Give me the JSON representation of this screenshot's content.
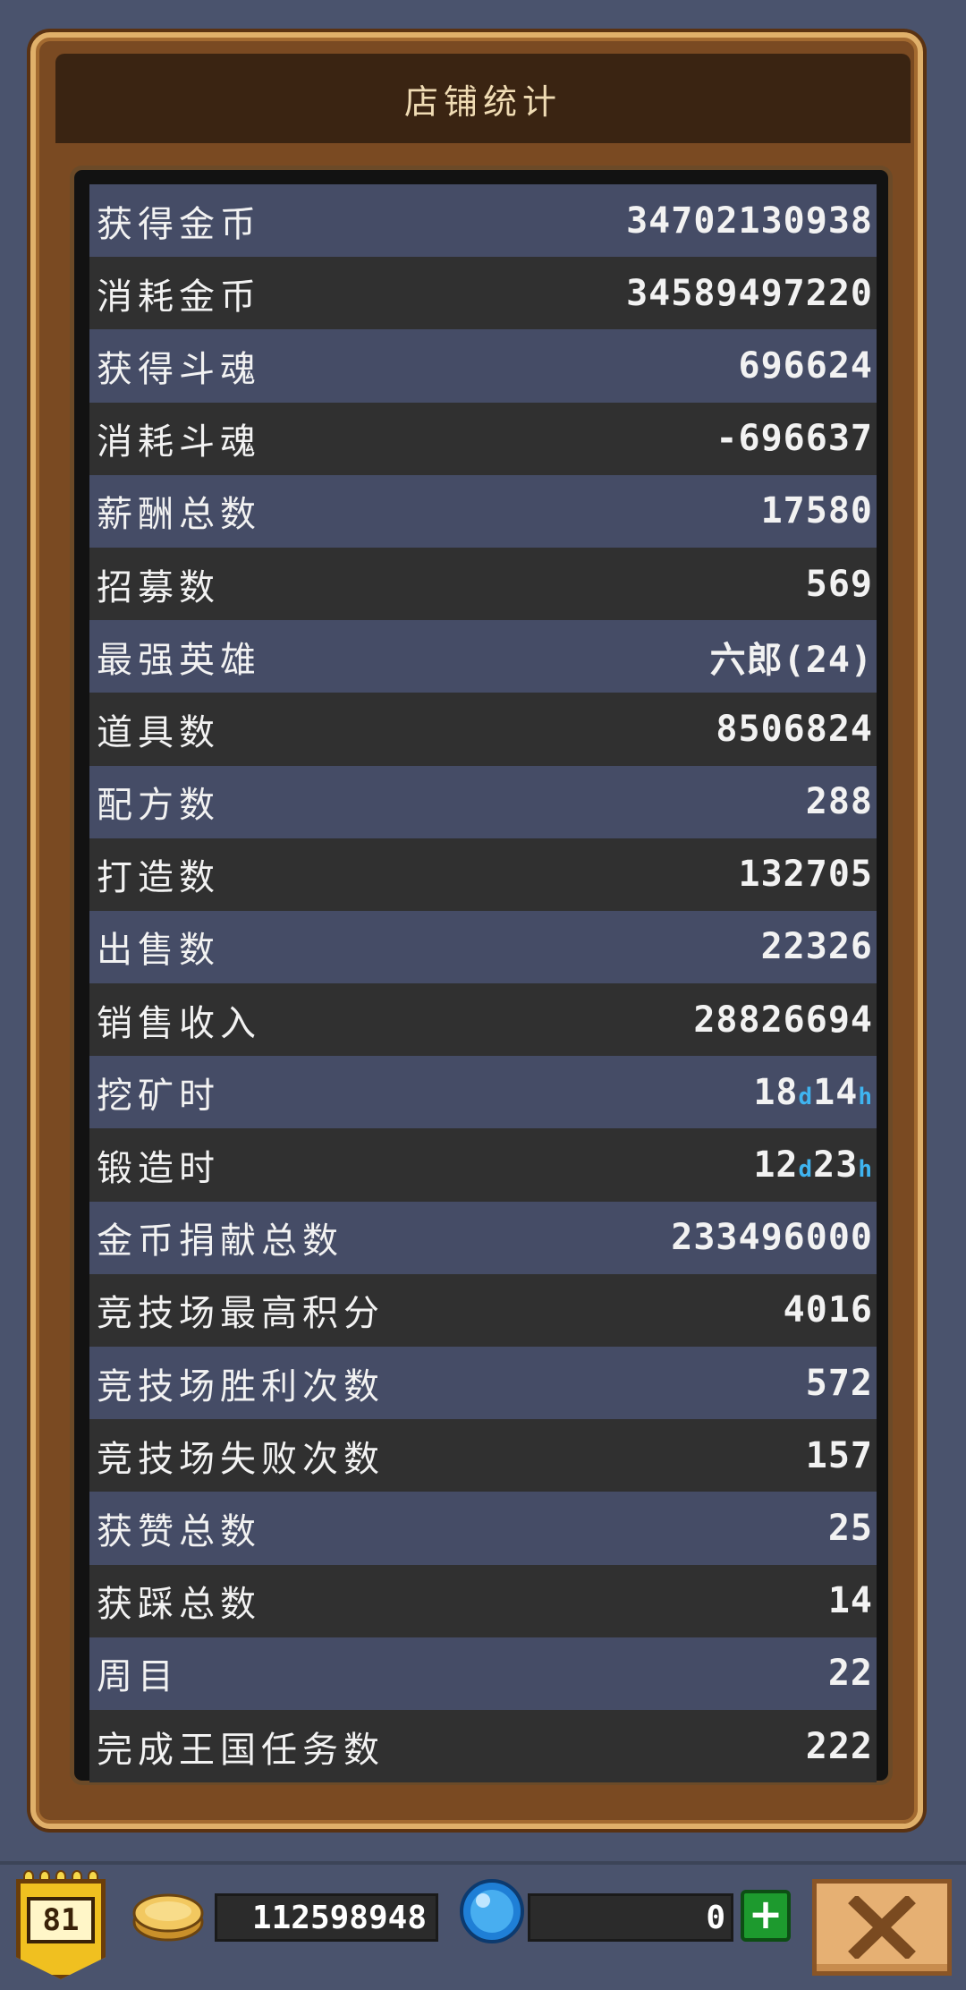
{
  "header": {
    "title": "店铺统计"
  },
  "stats": [
    {
      "label": "获得金币",
      "value": "34702130938"
    },
    {
      "label": "消耗金币",
      "value": "34589497220"
    },
    {
      "label": "获得斗魂",
      "value": "696624"
    },
    {
      "label": "消耗斗魂",
      "value": "-696637"
    },
    {
      "label": "薪酬总数",
      "value": "17580"
    },
    {
      "label": "招募数",
      "value": "569"
    },
    {
      "label": "最强英雄",
      "value": "六郎(24)"
    },
    {
      "label": "道具数",
      "value": "8506824"
    },
    {
      "label": "配方数",
      "value": "288"
    },
    {
      "label": "打造数",
      "value": "132705"
    },
    {
      "label": "出售数",
      "value": "22326"
    },
    {
      "label": "销售收入",
      "value": "28826694"
    },
    {
      "label": "挖矿时",
      "value_num1": "18",
      "unit1": "d",
      "value_num2": "14",
      "unit2": "h"
    },
    {
      "label": "锻造时",
      "value_num1": "12",
      "unit1": "d",
      "value_num2": "23",
      "unit2": "h"
    },
    {
      "label": "金币捐献总数",
      "value": "233496000"
    },
    {
      "label": "竞技场最高积分",
      "value": "4016"
    },
    {
      "label": "竞技场胜利次数",
      "value": "572"
    },
    {
      "label": "竞技场失败次数",
      "value": "157"
    },
    {
      "label": "获赞总数",
      "value": "25"
    },
    {
      "label": "获踩总数",
      "value": "14"
    },
    {
      "label": "周目",
      "value": "22"
    },
    {
      "label": "完成王国任务数",
      "value": "222"
    }
  ],
  "bottom_bar": {
    "level": "81",
    "gold": "112598948",
    "gems": "0",
    "add_label": "+",
    "icons": {
      "coin": "gold-coin-icon",
      "gem": "blue-gem-icon",
      "close": "close-x-icon",
      "level": "level-badge-icon"
    }
  },
  "colors": {
    "background": "#4a536d",
    "row_light": "#454c66",
    "row_dark": "#303030",
    "frame_gold": "#e0b06a",
    "unit_blue": "#3fb4f0",
    "add_green": "#1d9a2e"
  }
}
